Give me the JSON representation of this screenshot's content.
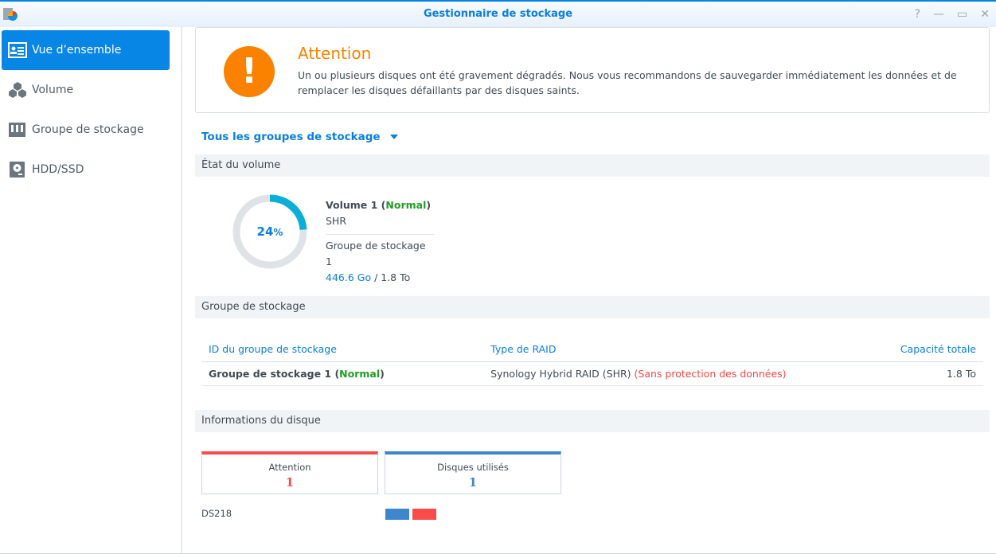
{
  "window": {
    "title": "Gestionnaire de stockage",
    "buttons": [
      "?",
      "—",
      "▭",
      "✕"
    ]
  },
  "sidebar": {
    "items": [
      {
        "label": "Vue d’ensemble",
        "icon": "overview-icon",
        "active": true
      },
      {
        "label": "Volume",
        "icon": "cubes-icon"
      },
      {
        "label": "Groupe de stockage",
        "icon": "storage-pool-icon"
      },
      {
        "label": "HDD/SSD",
        "icon": "disk-icon"
      }
    ]
  },
  "alert": {
    "icon": "!",
    "title": "Attention",
    "message": "Un ou plusieurs disques ont été gravement dégradés. Nous vous recommandons de sauvegarder immédiatement les données et de remplacer les disques défaillants par des disques saints."
  },
  "filter": {
    "selected": "Tous les groupes de stockage"
  },
  "volume_section": {
    "title": "État du volume",
    "usage_percent": 24,
    "usage_label": "24",
    "pct_sign": "%",
    "name": "Volume 1 (",
    "status": "Normal",
    "close": ")",
    "type": "SHR",
    "pool": "Groupe de stockage 1",
    "used": "446.6 Go",
    "total": " / 1.8 To"
  },
  "pool_section": {
    "title": "Groupe de stockage",
    "headers": [
      "ID du groupe de stockage",
      "Type de RAID",
      "Capacité totale"
    ],
    "rows": [
      {
        "name": "Groupe de stockage 1 (",
        "status": "Normal",
        "close": ")",
        "raid": "Synology Hybrid RAID (SHR) ",
        "raid_warning": "(Sans protection des données)",
        "capacity": "1.8 To"
      }
    ]
  },
  "disk_section": {
    "title": "Informations du disque",
    "cards": [
      {
        "label": "Attention",
        "value": "1",
        "color": "#f94b4b"
      },
      {
        "label": "Disques utilisés",
        "value": "1",
        "color": "#3d87cc"
      }
    ],
    "device": "DS218",
    "slots": [
      "#3d87cc",
      "#f94b4b"
    ]
  }
}
